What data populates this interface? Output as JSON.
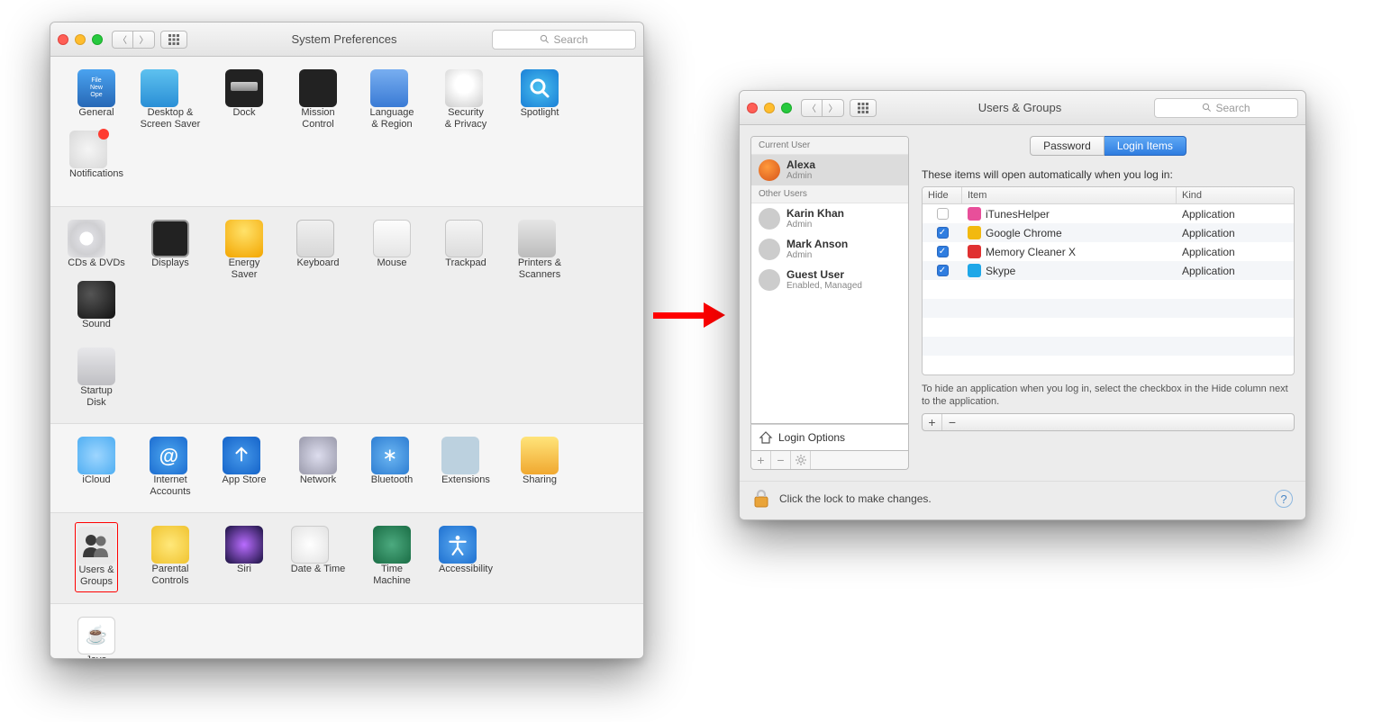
{
  "windowA": {
    "title": "System Preferences",
    "search_placeholder": "Search",
    "rows": [
      [
        {
          "id": "general",
          "label": "General"
        },
        {
          "id": "desktop",
          "label": "Desktop &\nScreen Saver"
        },
        {
          "id": "dock",
          "label": "Dock"
        },
        {
          "id": "mission",
          "label": "Mission\nControl"
        },
        {
          "id": "language",
          "label": "Language\n& Region"
        },
        {
          "id": "security",
          "label": "Security\n& Privacy"
        },
        {
          "id": "spotlight",
          "label": "Spotlight"
        },
        {
          "id": "notifications",
          "label": "Notifications",
          "badge": true
        }
      ],
      [
        {
          "id": "cds",
          "label": "CDs & DVDs"
        },
        {
          "id": "displays",
          "label": "Displays"
        },
        {
          "id": "energy",
          "label": "Energy\nSaver"
        },
        {
          "id": "keyboard",
          "label": "Keyboard"
        },
        {
          "id": "mouse",
          "label": "Mouse"
        },
        {
          "id": "trackpad",
          "label": "Trackpad"
        },
        {
          "id": "printers",
          "label": "Printers &\nScanners"
        },
        {
          "id": "sound",
          "label": "Sound"
        },
        {
          "id": "startup",
          "label": "Startup\nDisk"
        }
      ],
      [
        {
          "id": "icloud",
          "label": "iCloud"
        },
        {
          "id": "internet",
          "label": "Internet\nAccounts"
        },
        {
          "id": "appstore",
          "label": "App Store"
        },
        {
          "id": "network",
          "label": "Network"
        },
        {
          "id": "bluetooth",
          "label": "Bluetooth"
        },
        {
          "id": "extensions",
          "label": "Extensions"
        },
        {
          "id": "sharing",
          "label": "Sharing"
        }
      ],
      [
        {
          "id": "users",
          "label": "Users &\nGroups",
          "highlight": true
        },
        {
          "id": "parental",
          "label": "Parental\nControls"
        },
        {
          "id": "siri",
          "label": "Siri"
        },
        {
          "id": "datetime",
          "label": "Date & Time"
        },
        {
          "id": "timemachine",
          "label": "Time\nMachine"
        },
        {
          "id": "accessibility",
          "label": "Accessibility"
        }
      ],
      [
        {
          "id": "java",
          "label": "Java"
        }
      ]
    ]
  },
  "windowB": {
    "title": "Users & Groups",
    "search_placeholder": "Search",
    "sidebar": {
      "current_header": "Current User",
      "other_header": "Other Users",
      "current": {
        "name": "Alexa",
        "role": "Admin"
      },
      "others": [
        {
          "name": "Karin Khan",
          "role": "Admin"
        },
        {
          "name": "Mark Anson",
          "role": "Admin"
        },
        {
          "name": "Guest User",
          "role": "Enabled, Managed"
        }
      ],
      "login_options": "Login Options"
    },
    "tabs": {
      "password": "Password",
      "login_items": "Login Items"
    },
    "instruction": "These items will open automatically when you log in:",
    "table": {
      "headers": {
        "hide": "Hide",
        "item": "Item",
        "kind": "Kind"
      },
      "rows": [
        {
          "hide": false,
          "name": "iTunesHelper",
          "kind": "Application",
          "color": "#e84f9a"
        },
        {
          "hide": true,
          "name": "Google Chrome",
          "kind": "Application",
          "color": "#f2b90f"
        },
        {
          "hide": true,
          "name": "Memory Cleaner X",
          "kind": "Application",
          "color": "#e03131"
        },
        {
          "hide": true,
          "name": "Skype",
          "kind": "Application",
          "color": "#1ea7e8"
        }
      ]
    },
    "hint": "To hide an application when you log in, select the checkbox in the Hide column next to the application.",
    "lock_text": "Click the lock to make changes."
  }
}
